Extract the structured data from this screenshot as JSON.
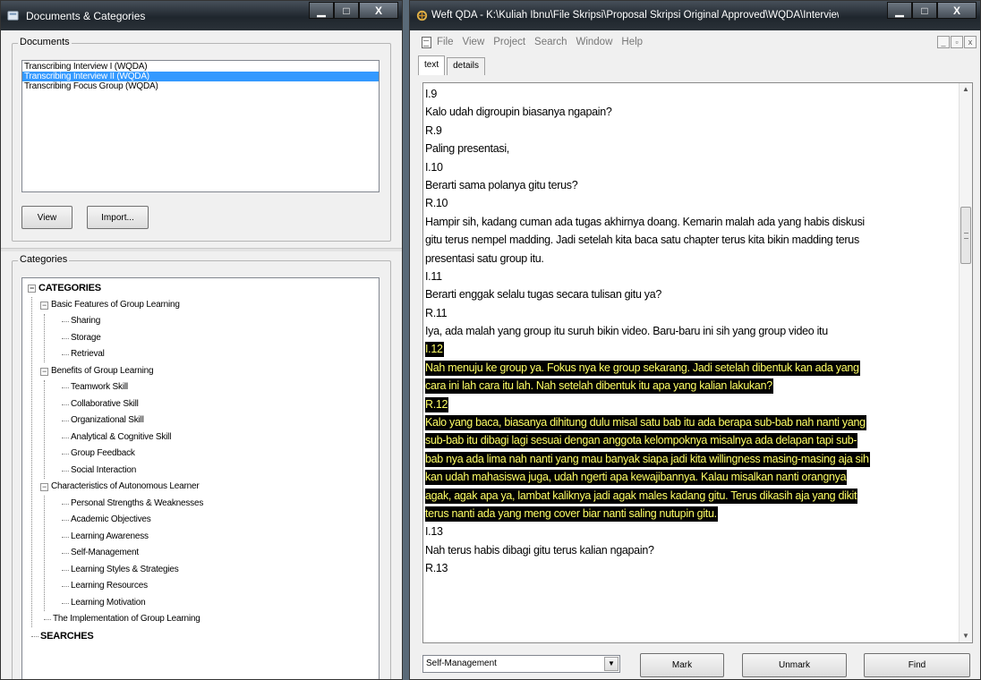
{
  "left_window": {
    "title": "Documents & Categories",
    "documents_group_label": "Documents",
    "documents": [
      {
        "label": "Transcribing Interview I (WQDA)",
        "selected": false
      },
      {
        "label": "Transcribing Interview II (WQDA)",
        "selected": true
      },
      {
        "label": "Transcribing Focus Group (WQDA)",
        "selected": false
      }
    ],
    "view_button": "View",
    "import_button": "Import...",
    "categories_group_label": "Categories",
    "tree": [
      {
        "label": "CATEGORIES",
        "level": 0,
        "expander": "−",
        "bold": true
      },
      {
        "label": "Basic Features of Group Learning",
        "level": 1,
        "expander": "−"
      },
      {
        "label": "Sharing",
        "level": 2
      },
      {
        "label": "Storage",
        "level": 2
      },
      {
        "label": "Retrieval",
        "level": 2
      },
      {
        "label": "Benefits of Group Learning",
        "level": 1,
        "expander": "−"
      },
      {
        "label": "Teamwork Skill",
        "level": 2
      },
      {
        "label": "Collaborative Skill",
        "level": 2
      },
      {
        "label": "Organizational Skill",
        "level": 2
      },
      {
        "label": "Analytical & Cognitive Skill",
        "level": 2
      },
      {
        "label": "Group Feedback",
        "level": 2
      },
      {
        "label": "Social Interaction",
        "level": 2
      },
      {
        "label": "Characteristics of Autonomous Learner",
        "level": 1,
        "expander": "−"
      },
      {
        "label": "Personal Strengths & Weaknesses",
        "level": 2
      },
      {
        "label": "Academic Objectives",
        "level": 2
      },
      {
        "label": "Learning Awareness",
        "level": 2
      },
      {
        "label": "Self-Management",
        "level": 2
      },
      {
        "label": "Learning Styles & Strategies",
        "level": 2
      },
      {
        "label": "Learning Resources",
        "level": 2
      },
      {
        "label": "Learning Motivation",
        "level": 2
      },
      {
        "label": "The Implementation of Group Learning",
        "level": 1
      },
      {
        "label": "SEARCHES",
        "level": 0,
        "bold": true
      }
    ]
  },
  "right_window": {
    "title": "Weft QDA - K:\\Kuliah Ibnu\\File Skripsi\\Proposal Skripsi Original Approved\\WQDA\\Interview I Coding.qdp*...",
    "menu": [
      "File",
      "View",
      "Project",
      "Search",
      "Window",
      "Help"
    ],
    "tabs": [
      {
        "label": "text",
        "active": true
      },
      {
        "label": "details",
        "active": false
      }
    ],
    "text_lines": [
      {
        "text": "I.9",
        "highlight": false
      },
      {
        "text": "Kalo udah digroupin biasanya ngapain?",
        "highlight": false
      },
      {
        "text": "R.9",
        "highlight": false
      },
      {
        "text": "Paling presentasi,",
        "highlight": false
      },
      {
        "text": "I.10",
        "highlight": false
      },
      {
        "text": "Berarti sama polanya gitu terus?",
        "highlight": false
      },
      {
        "text": "R.10",
        "highlight": false
      },
      {
        "text": "Hampir sih, kadang cuman ada tugas akhirnya doang. Kemarin malah ada yang habis diskusi",
        "highlight": false
      },
      {
        "text": "gitu terus nempel madding. Jadi setelah kita baca satu chapter terus kita bikin madding terus",
        "highlight": false
      },
      {
        "text": "presentasi satu group itu.",
        "highlight": false
      },
      {
        "text": "I.11",
        "highlight": false
      },
      {
        "text": "Berarti enggak selalu tugas secara tulisan gitu ya?",
        "highlight": false
      },
      {
        "text": "R.11",
        "highlight": false
      },
      {
        "text": "Iya, ada malah yang group itu suruh bikin video. Baru-baru ini sih yang group video itu",
        "highlight": false
      },
      {
        "text": "I.12",
        "highlight": true
      },
      {
        "text": "Nah menuju ke group ya. Fokus nya ke group sekarang. Jadi setelah dibentuk kan ada yang",
        "highlight": true
      },
      {
        "text": "cara ini lah cara itu lah. Nah setelah dibentuk itu apa yang kalian lakukan?",
        "highlight": true
      },
      {
        "text": "R.12",
        "highlight": true
      },
      {
        "text": "Kalo yang baca, biasanya dihitung dulu misal satu bab itu ada berapa sub-bab nah nanti yang",
        "highlight": true
      },
      {
        "text": "sub-bab itu dibagi lagi sesuai dengan anggota kelompoknya misalnya ada delapan tapi sub-",
        "highlight": true
      },
      {
        "text": "bab nya ada lima nah nanti yang mau banyak siapa jadi kita willingness masing-masing aja sih",
        "highlight": true
      },
      {
        "text": "kan udah mahasiswa juga, udah ngerti apa kewajibannya. Kalau misalkan nanti orangnya",
        "highlight": true
      },
      {
        "text": "agak, agak apa ya, lambat kaliknya jadi agak males kadang gitu. Terus dikasih aja yang dikit",
        "highlight": true
      },
      {
        "text": "terus nanti ada yang meng cover biar nanti saling nutupin gitu.",
        "highlight": true
      },
      {
        "text": "I.13",
        "highlight": false
      },
      {
        "text": "Nah terus habis dibagi gitu terus kalian ngapain?",
        "highlight": false
      },
      {
        "text": "R.13",
        "highlight": false
      }
    ],
    "category_select_value": "Self-Management",
    "mark_button": "Mark",
    "unmark_button": "Unmark",
    "find_button": "Find"
  },
  "colors": {
    "selection_blue": "#3399ff",
    "highlight_background": "#000000",
    "highlight_text": "#ffff66",
    "titlebar_dark": "#1f262d"
  }
}
